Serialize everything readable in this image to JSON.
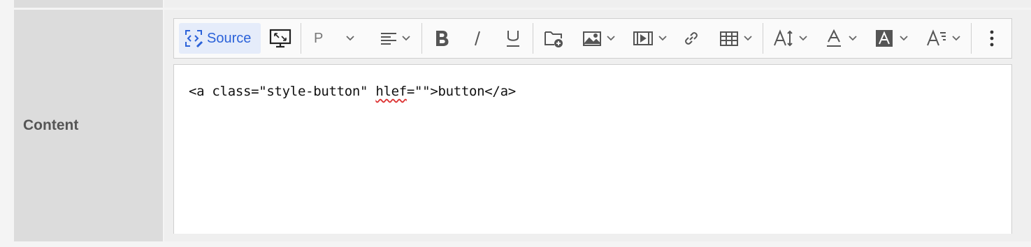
{
  "form": {
    "row_label": "Content"
  },
  "toolbar": {
    "source_label": "Source",
    "paragraph_label": "P",
    "icons": [
      "source-icon",
      "fullscreen-icon",
      "paragraph-dropdown",
      "align-icon",
      "bold-icon",
      "italic-icon",
      "underline-icon",
      "file-manager-icon",
      "image-icon",
      "media-icon",
      "link-icon",
      "table-icon",
      "font-size-icon",
      "font-color-icon",
      "background-color-icon",
      "text-style-icon",
      "more-icon"
    ]
  },
  "editor": {
    "line1_before": "<a class=\"style-button\" ",
    "line1_misspelled": "hlef",
    "line1_after": "=\"\">button</a>"
  },
  "colors": {
    "accent": "#2b62d9",
    "source_bg": "#e5ecfa",
    "icon": "#555555",
    "label_bg": "#dcdcdc"
  }
}
